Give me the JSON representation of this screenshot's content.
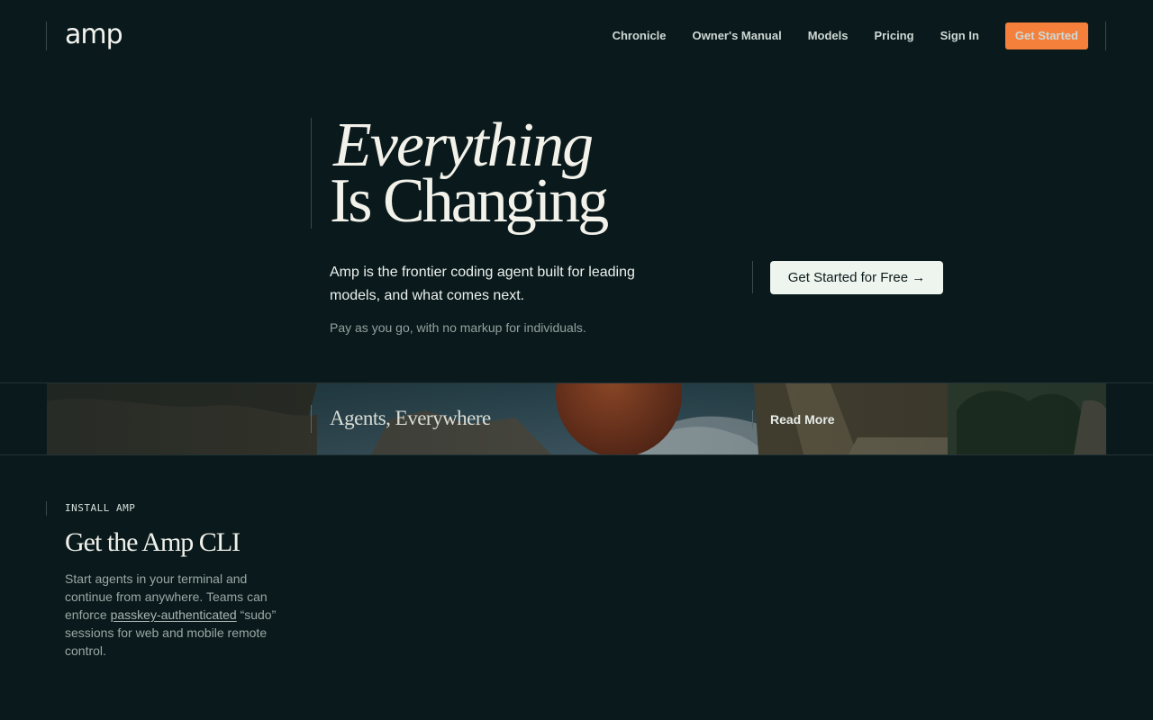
{
  "header": {
    "logo": "amp",
    "nav": [
      "Chronicle",
      "Owner's Manual",
      "Models",
      "Pricing",
      "Sign In"
    ],
    "cta": "Get Started"
  },
  "hero": {
    "line1": "Everything",
    "line2": "Is Changing",
    "lead": "Amp is the frontier coding agent built for leading models, and what comes next.",
    "sub": "Pay as you go, with no markup for individuals.",
    "cta": "Get Started for Free →"
  },
  "banner": {
    "title": "Agents, Everywhere",
    "link": "Read More"
  },
  "install": {
    "kicker": "INSTALL AMP",
    "title": "Get the Amp CLI",
    "body_pre": "Start agents in your terminal and continue from anywhere. Teams can enforce ",
    "body_link": "passkey-authenticated",
    "body_post": " “sudo” sessions for web and mobile remote control."
  },
  "colors": {
    "background": "#0a1a1c",
    "accent": "#f4803c",
    "button_light": "#eef4ee"
  }
}
